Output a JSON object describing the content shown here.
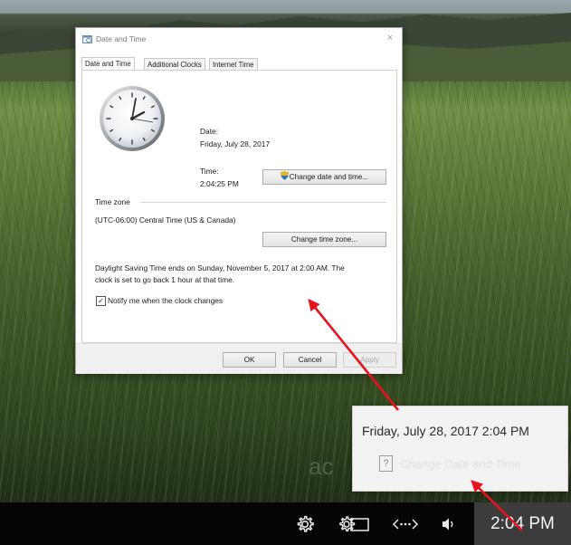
{
  "dialog": {
    "title": "Date and Time",
    "close_glyph": "×",
    "tabs": [
      {
        "label": "Date and Time",
        "active": true
      },
      {
        "label": "Additional Clocks",
        "active": false
      },
      {
        "label": "Internet Time",
        "active": false
      }
    ],
    "date_label": "Date:",
    "date_value": "Friday, July 28, 2017",
    "time_label": "Time:",
    "time_value": "2:04:25 PM",
    "change_datetime_button": "Change date and time...",
    "timezone_group_label": "Time zone",
    "timezone_value": "(UTC-06:00) Central Time (US & Canada)",
    "change_timezone_button": "Change time zone...",
    "dst_line1": "Daylight Saving Time ends on Sunday, November 5, 2017 at 2:00 AM. The",
    "dst_line2": "clock is set to go back 1 hour at that time.",
    "notify_checkbox_label": "Notify me when the clock changes",
    "notify_checked": true,
    "ok_button": "OK",
    "cancel_button": "Cancel",
    "apply_button": "Apply"
  },
  "flyout": {
    "date_time": "Friday, July 28, 2017 2:04 PM",
    "help_glyph": "?",
    "link": "Change Date and Time"
  },
  "taskbar": {
    "clock": "2:04 PM",
    "icons": [
      "gear-icon",
      "screen-settings-icon",
      "network-icon",
      "volume-icon"
    ]
  },
  "colors": {
    "annotation_arrow": "#e8121b",
    "taskbar_bg": "#050505",
    "taskbar_clock_bg": "#3c3c3c"
  }
}
